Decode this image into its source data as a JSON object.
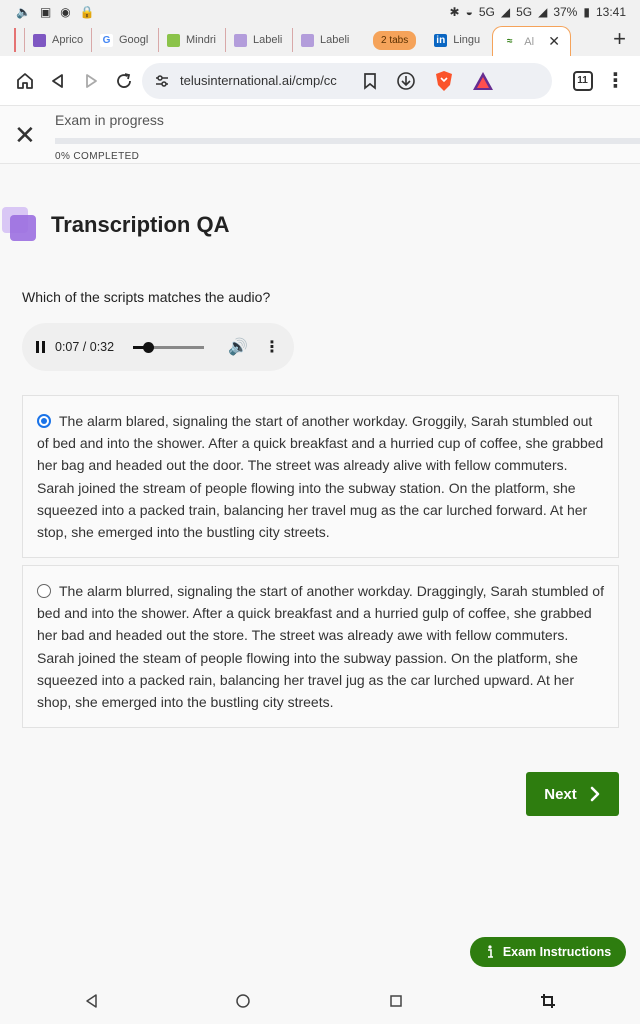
{
  "status_bar": {
    "network": "5G",
    "network2": "5G",
    "battery": "37%",
    "time": "13:41"
  },
  "tabs": [
    {
      "label": "",
      "favicon_color": "#e57373"
    },
    {
      "label": "Aprico",
      "favicon_color": "#7e57c2"
    },
    {
      "label": "Googl",
      "favicon_color": "#4285f4"
    },
    {
      "label": "Mindri",
      "favicon_color": "#8bc34a"
    },
    {
      "label": "Labeli",
      "favicon_color": "#b39ddb"
    },
    {
      "label": "Labeli",
      "favicon_color": "#b39ddb"
    }
  ],
  "tab_group_chip": "2 tabs",
  "tab_after_chip": {
    "label": "Lingu",
    "favicon_color": "#0a66c2",
    "favicon_glyph": "in"
  },
  "active_tab": {
    "label": "Al"
  },
  "toolbar": {
    "url": "telusinternational.ai/cmp/cc",
    "tab_count": "11"
  },
  "exam": {
    "status_title": "Exam in progress",
    "progress_label": "0% COMPLETED",
    "progress": 0
  },
  "section_title": "Transcription QA",
  "question": "Which of the scripts matches the audio?",
  "audio": {
    "time": "0:07 / 0:32",
    "progress": 0.22
  },
  "options": [
    {
      "text": "The alarm blared, signaling the start of another workday. Groggily, Sarah stumbled out of bed and into the shower. After a quick breakfast and a hurried cup of coffee, she grabbed her bag and headed out the door. The street was already alive with fellow commuters. Sarah joined the stream of people flowing into the subway station. On the platform, she squeezed into a packed train, balancing her travel mug as the car lurched forward. At her stop, she emerged into the bustling city streets.",
      "selected": true
    },
    {
      "text": "The alarm blurred, signaling the start of another workday. Draggingly, Sarah stumbled of bed and into the shower. After a quick breakfast and a hurried gulp of coffee, she grabbed her bad and headed out the store. The street was already awe with fellow commuters. Sarah joined the steam of people flowing into the subway passion. On the platform, she squeezed into a packed rain, balancing her travel jug as the car lurched upward. At her shop, she emerged into the bustling city streets.",
      "selected": false
    }
  ],
  "next_label": "Next",
  "instructions_label": "Exam Instructions",
  "colors": {
    "accent_green": "#2e7d0f",
    "radio_blue": "#1a73e8",
    "tab_group_orange": "#f5a35a"
  }
}
